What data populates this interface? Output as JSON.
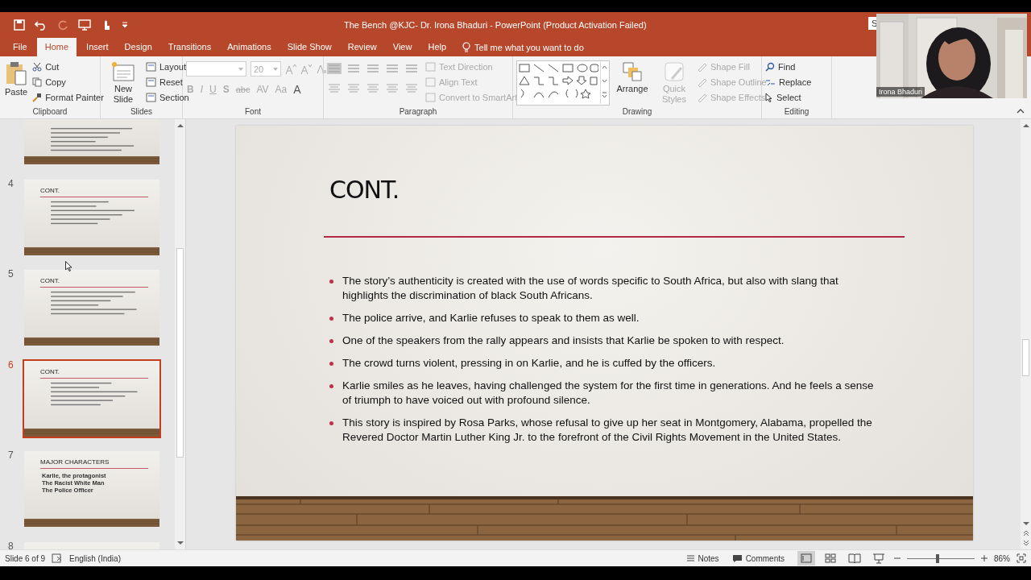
{
  "window": {
    "title": "The Bench @KJC- Dr. Irona Bhaduri  -  PowerPoint (Product Activation Failed)",
    "sign_in": "S"
  },
  "tabs": [
    {
      "label": "File",
      "selected": false
    },
    {
      "label": "Home",
      "selected": true
    },
    {
      "label": "Insert",
      "selected": false
    },
    {
      "label": "Design",
      "selected": false
    },
    {
      "label": "Transitions",
      "selected": false
    },
    {
      "label": "Animations",
      "selected": false
    },
    {
      "label": "Slide Show",
      "selected": false
    },
    {
      "label": "Review",
      "selected": false
    },
    {
      "label": "View",
      "selected": false
    },
    {
      "label": "Help",
      "selected": false
    }
  ],
  "tell_me": "Tell me what you want to do",
  "ribbon": [
    {
      "kind": "clipboard",
      "label": "Clipboard",
      "big": {
        "label": "Paste",
        "disabled": false
      },
      "items": [
        {
          "label": "Cut",
          "disabled": false
        },
        {
          "label": "Copy",
          "disabled": false
        },
        {
          "label": "Format Painter",
          "disabled": false
        }
      ]
    },
    {
      "kind": "slides",
      "label": "Slides",
      "big": {
        "label": "New Slide",
        "disabled": false
      },
      "items": [
        {
          "label": "Layout",
          "disabled": false
        },
        {
          "label": "Reset",
          "disabled": false
        },
        {
          "label": "Section",
          "disabled": false
        }
      ]
    },
    {
      "kind": "font",
      "label": "Font",
      "font_size": "20",
      "buttons": [
        {
          "label": "B",
          "disabled": true
        },
        {
          "label": "I",
          "disabled": true
        },
        {
          "label": "U",
          "disabled": true
        },
        {
          "label": "S",
          "disabled": true
        },
        {
          "label": "abc",
          "disabled": true
        },
        {
          "label": "AV",
          "disabled": true
        },
        {
          "label": "Aa",
          "disabled": true
        },
        {
          "label": "A",
          "disabled": false
        }
      ]
    },
    {
      "kind": "paragraph",
      "label": "Paragraph",
      "items": [
        {
          "label": "Text Direction",
          "disabled": true
        },
        {
          "label": "Align Text",
          "disabled": true
        },
        {
          "label": "Convert to SmartArt",
          "disabled": true
        }
      ]
    },
    {
      "kind": "drawing",
      "label": "Drawing",
      "bigs": [
        {
          "label": "Arrange",
          "disabled": false
        },
        {
          "label": "Quick Styles",
          "disabled": true
        }
      ],
      "items": [
        {
          "label": "Shape Fill",
          "disabled": true
        },
        {
          "label": "Shape Outline",
          "disabled": true
        },
        {
          "label": "Shape Effects",
          "disabled": true
        }
      ]
    },
    {
      "kind": "editing",
      "label": "Editing",
      "items": [
        {
          "label": "Find",
          "disabled": false
        },
        {
          "label": "Replace",
          "disabled": false
        },
        {
          "label": "Select",
          "disabled": false
        }
      ]
    }
  ],
  "thumbnails": [
    {
      "selected": false
    },
    {
      "number": "4",
      "title": "CONT.",
      "selected": false
    },
    {
      "number": "5",
      "title": "CONT.",
      "selected": false
    },
    {
      "number": "6",
      "title": "CONT.",
      "selected": true
    },
    {
      "number": "7",
      "title": "MAJOR CHARACTERS",
      "bullets": [
        "Karlie, the protagonist",
        "The Racist White Man",
        "The Police Officer"
      ],
      "selected": false
    },
    {
      "number": "8",
      "selected": false
    }
  ],
  "slide": {
    "title": "CONT.",
    "bullets": [
      "The story’s authenticity is created with the use of words specific to South Africa, but also with slang that highlights the discrimination of black South Africans.",
      "The police arrive, and Karlie refuses to speak to them as well.",
      "One of the speakers from the rally appears and insists that Karlie be spoken to with respect.",
      "The crowd turns violent, pressing in on Karlie, and he is cuffed by the officers.",
      "Karlie smiles as he leaves, having challenged the system for the first time in generations.  And he feels a sense of triumph to have voiced out with profound silence.",
      "This story is inspired by Rosa Parks, whose refusal to give up her seat in Montgomery, Alabama, propelled the Revered Doctor Martin Luther King Jr. to the forefront of the Civil Rights Movement in the United States."
    ]
  },
  "webcam": {
    "name": "Irona Bhaduri"
  },
  "status_bar": {
    "slide": "Slide 6 of 9",
    "language": "English (India)",
    "notes": "Notes",
    "comments": "Comments",
    "zoom": {
      "level": 0.45
    },
    "zoom_text": "86%"
  }
}
